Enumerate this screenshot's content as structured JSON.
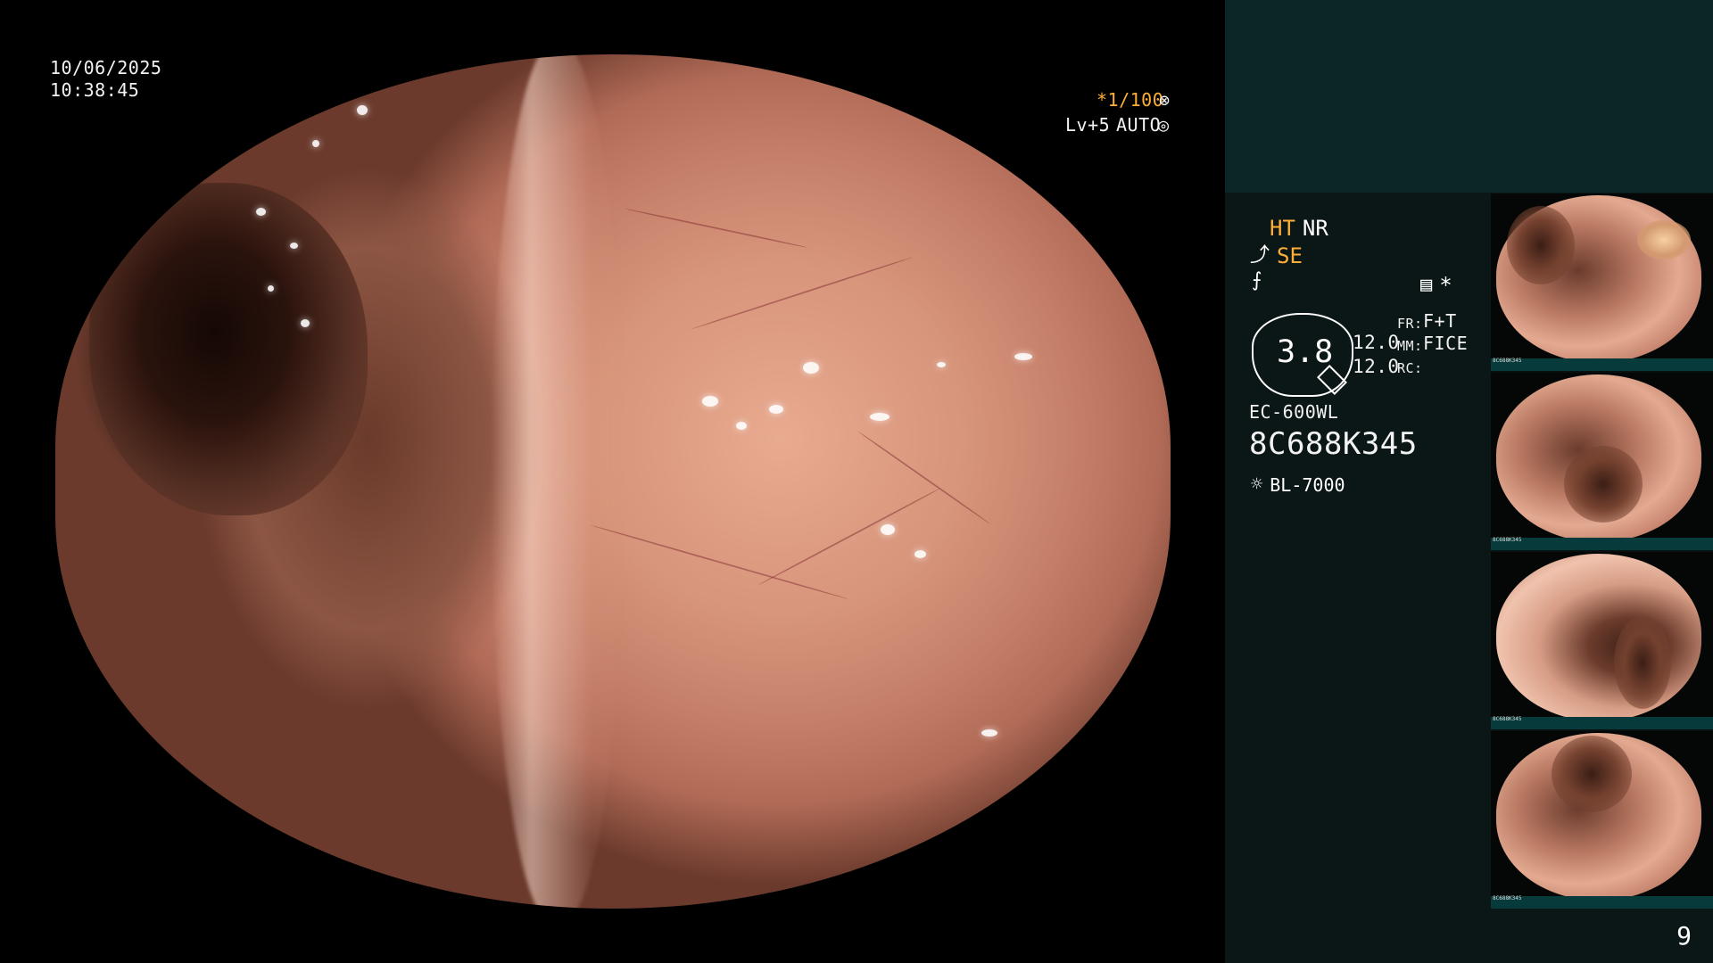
{
  "main_display": {
    "date": "10/06/2025",
    "time": "10:38:45",
    "shutter": "*1/100",
    "shutter_icon": "aperture-icon",
    "level": "Lv+5",
    "mode": "AUTO",
    "mode_icon": "iris-icon"
  },
  "settings": {
    "line1_part1": "HT",
    "line1_part2": "NR",
    "line2_icon": "structure-icon",
    "line2_text": "SE",
    "line3_icon": "brightness-icon",
    "line3_right_icon": "menu-icon",
    "line3_right_symbol": "*",
    "exposure_value": "3.8",
    "fr_label": "FR:",
    "fr_value": "F+T",
    "mm_label": "MM:",
    "mm_value": "FICE",
    "rc_label": "RC:",
    "value1": "12.0",
    "value2": "12.0",
    "model": "EC-600WL",
    "serial": "8C688K345",
    "light_source_icon": "light-icon",
    "light_source": "BL-7000"
  },
  "thumbnails": [
    {
      "caption": "8C688K345"
    },
    {
      "caption": "8C688K345"
    },
    {
      "caption": "8C688K345"
    },
    {
      "caption": "8C688K345"
    }
  ],
  "page_number": "9"
}
